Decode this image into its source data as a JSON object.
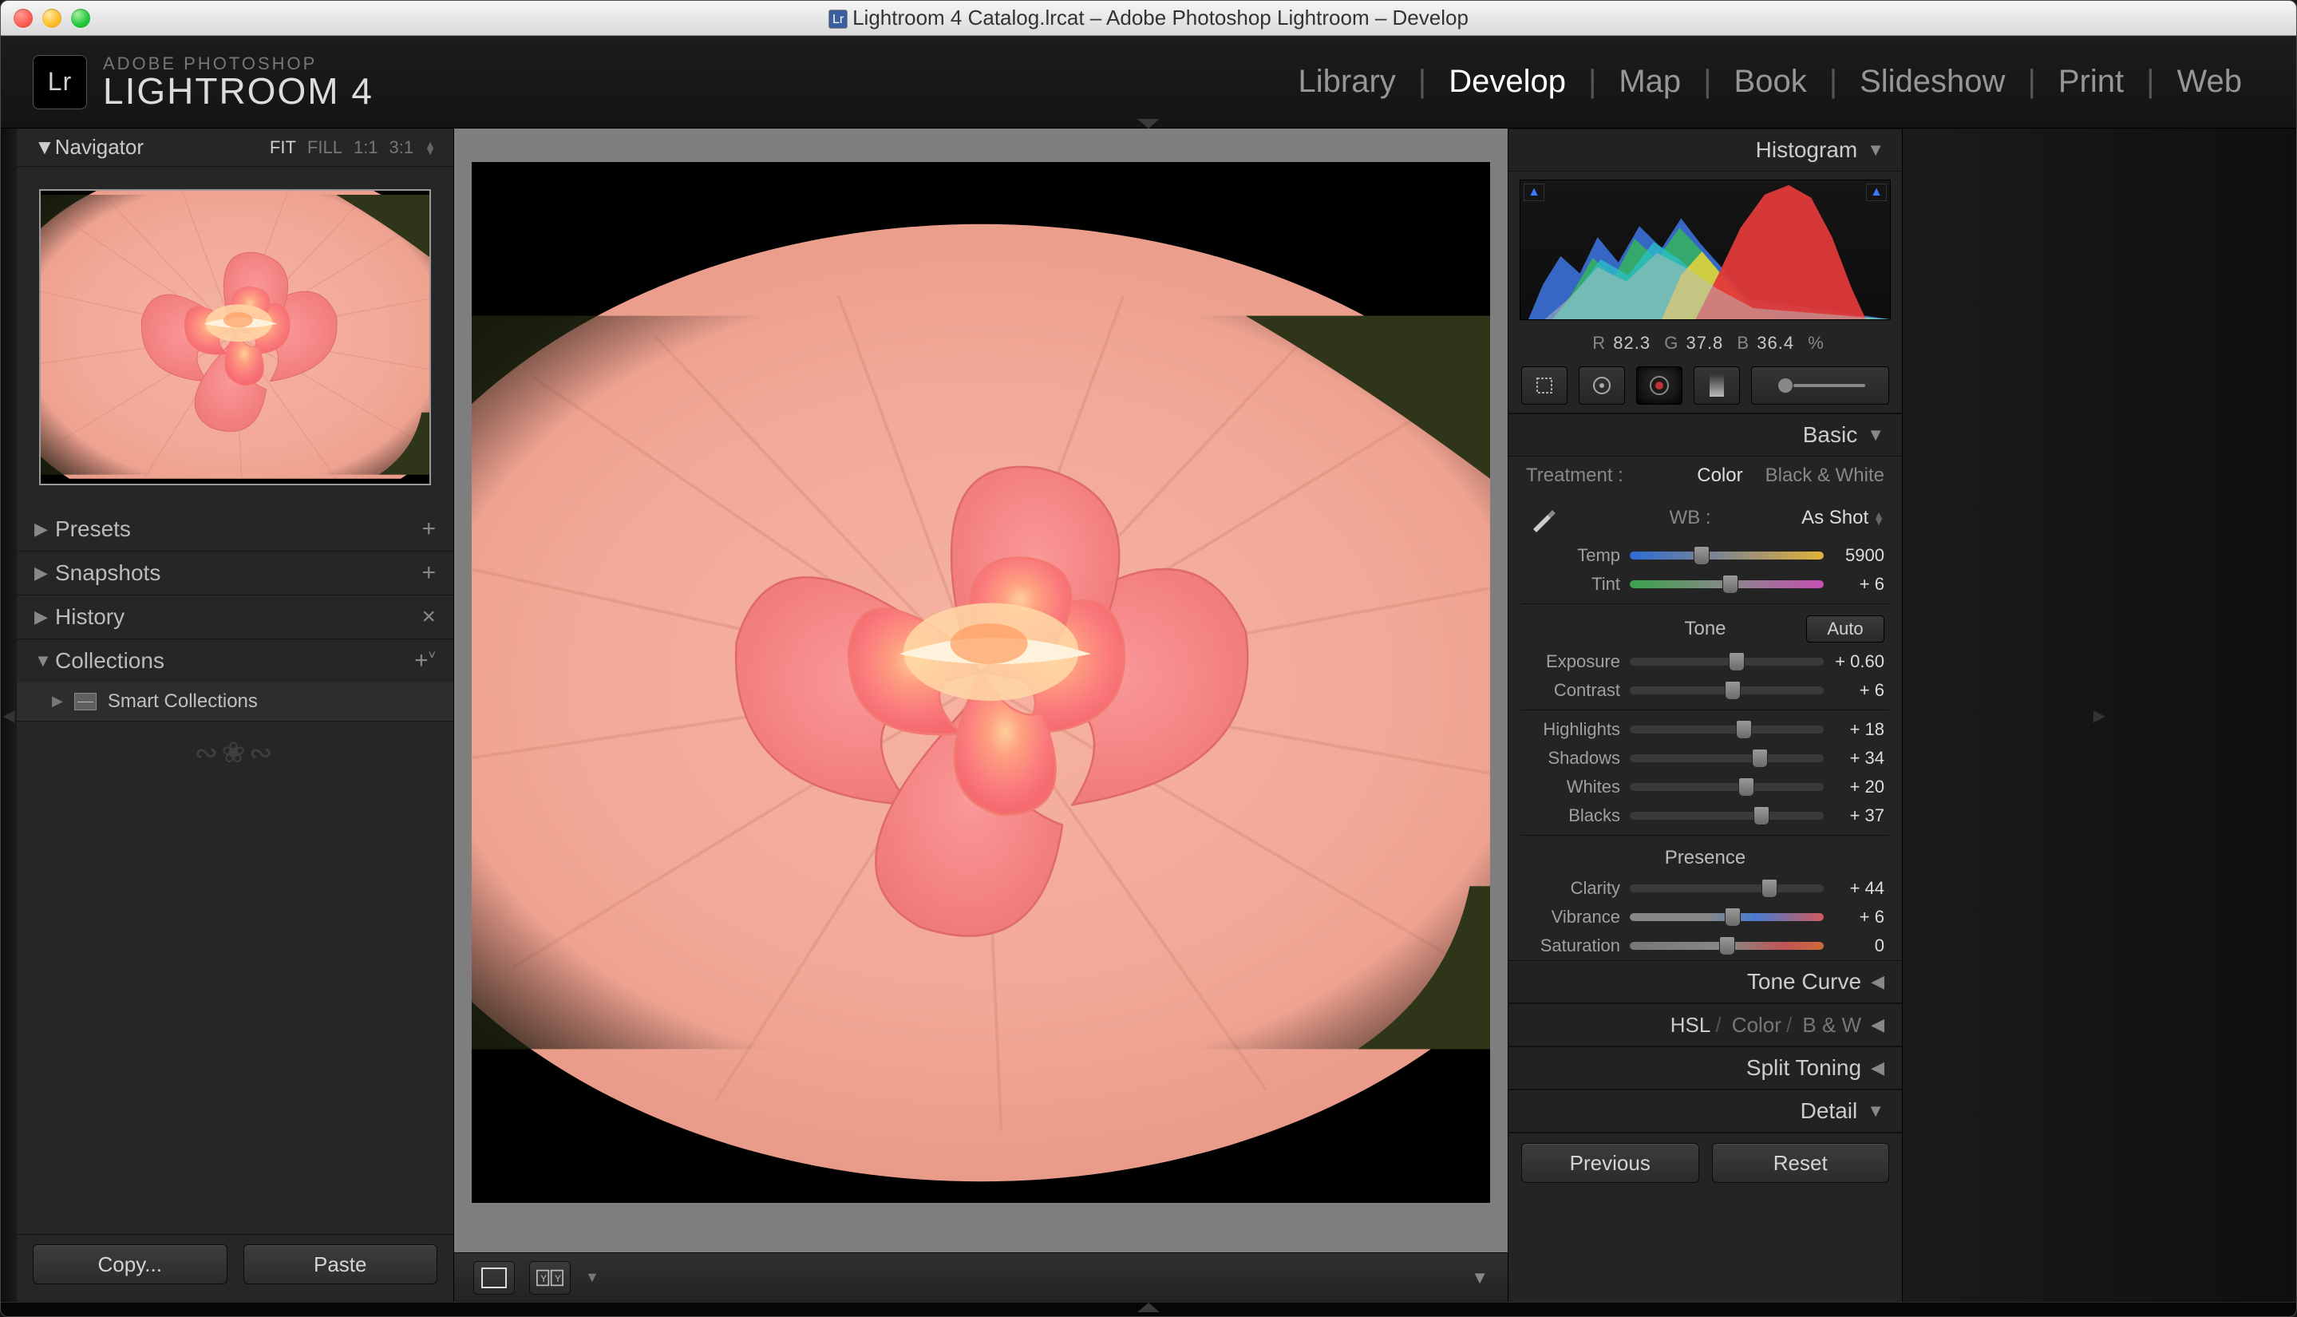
{
  "window": {
    "title": "Lightroom 4 Catalog.lrcat – Adobe Photoshop Lightroom – Develop"
  },
  "header": {
    "logo_badge": "Lr",
    "brand_line1": "ADOBE PHOTOSHOP",
    "brand_line2": "LIGHTROOM 4",
    "modules": {
      "library": "Library",
      "develop": "Develop",
      "map": "Map",
      "book": "Book",
      "slideshow": "Slideshow",
      "print": "Print",
      "web": "Web"
    }
  },
  "left": {
    "navigator": {
      "title": "Navigator",
      "zoom": {
        "fit": "FIT",
        "fill": "FILL",
        "one": "1:1",
        "three": "3:1"
      }
    },
    "presets": {
      "title": "Presets"
    },
    "snapshots": {
      "title": "Snapshots"
    },
    "history": {
      "title": "History"
    },
    "collections": {
      "title": "Collections",
      "smart": "Smart Collections"
    },
    "buttons": {
      "copy": "Copy...",
      "paste": "Paste"
    }
  },
  "right": {
    "histogram": {
      "title": "Histogram",
      "rgb": {
        "r_label": "R",
        "r": "82.3",
        "g_label": "G",
        "g": "37.8",
        "b_label": "B",
        "b": "36.4",
        "pct": "%"
      }
    },
    "basic": {
      "title": "Basic",
      "treatment": {
        "label": "Treatment :",
        "color": "Color",
        "bw": "Black & White"
      },
      "wb": {
        "label": "WB :",
        "value": "As Shot"
      },
      "temp": {
        "label": "Temp",
        "value": "5900",
        "pos": 37
      },
      "tint": {
        "label": "Tint",
        "value": "+ 6",
        "pos": 52
      },
      "tone": {
        "title": "Tone",
        "auto": "Auto"
      },
      "exposure": {
        "label": "Exposure",
        "value": "+ 0.60",
        "pos": 55
      },
      "contrast": {
        "label": "Contrast",
        "value": "+ 6",
        "pos": 53
      },
      "highlights": {
        "label": "Highlights",
        "value": "+ 18",
        "pos": 59
      },
      "shadows": {
        "label": "Shadows",
        "value": "+ 34",
        "pos": 67
      },
      "whites": {
        "label": "Whites",
        "value": "+ 20",
        "pos": 60
      },
      "blacks": {
        "label": "Blacks",
        "value": "+ 37",
        "pos": 68
      },
      "presence": {
        "title": "Presence"
      },
      "clarity": {
        "label": "Clarity",
        "value": "+ 44",
        "pos": 72
      },
      "vibrance": {
        "label": "Vibrance",
        "value": "+ 6",
        "pos": 53
      },
      "saturation": {
        "label": "Saturation",
        "value": "0",
        "pos": 50
      }
    },
    "tone_curve": {
      "title": "Tone Curve"
    },
    "hsl": {
      "hsl": "HSL",
      "color": "Color",
      "bw": "B & W"
    },
    "split_toning": {
      "title": "Split Toning"
    },
    "detail": {
      "title": "Detail"
    },
    "buttons": {
      "prev": "Previous",
      "reset": "Reset"
    }
  }
}
